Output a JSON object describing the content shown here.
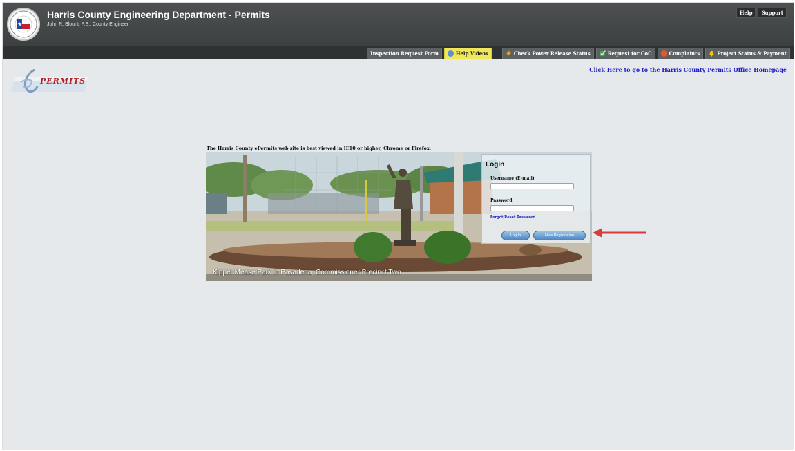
{
  "header": {
    "title": "Harris County Engineering Department - Permits",
    "subtitle": "John R. Blount, P.E., County Engineer",
    "top_links": [
      "Help",
      "Support"
    ]
  },
  "nav": {
    "items": [
      {
        "label": "Inspection Request Form",
        "icon": "none"
      },
      {
        "label": "Help Videos",
        "icon": "globe-icon",
        "highlight": true
      },
      {
        "label": "Check Power Release Status",
        "icon": "lightning-icon"
      },
      {
        "label": "Request for CoC",
        "icon": "checkbox-icon"
      },
      {
        "label": "Complaints",
        "icon": "complaint-icon"
      },
      {
        "label": "Project Status & Payment",
        "icon": "bell-icon"
      }
    ]
  },
  "logo": {
    "text": "PERMITS"
  },
  "home_link": "Click Here to go to the Harris County Permits Office Homepage",
  "notice": "The Harris County ePermits web site is best viewed in IE10 or higher, Chrome or Firefox.",
  "hero": {
    "caption": "Kipper Mease Park in Pasadena, Commissioner Precinct Two"
  },
  "login": {
    "title": "Login",
    "username_label": "Username (E-mail)",
    "username_value": "",
    "password_label": "Password",
    "password_value": "",
    "forgot_link": "Forgot/Reset Password",
    "login_button": "Log In",
    "register_button": "New Registration"
  },
  "colors": {
    "header_bg": "#45494a",
    "nav_bg": "#2f3233",
    "page_bg": "#e6e9eb",
    "link_blue": "#1c1cc8",
    "highlight_yellow": "#f0e85a",
    "logo_red": "#b31e22",
    "arrow_red": "#d93a3a"
  }
}
